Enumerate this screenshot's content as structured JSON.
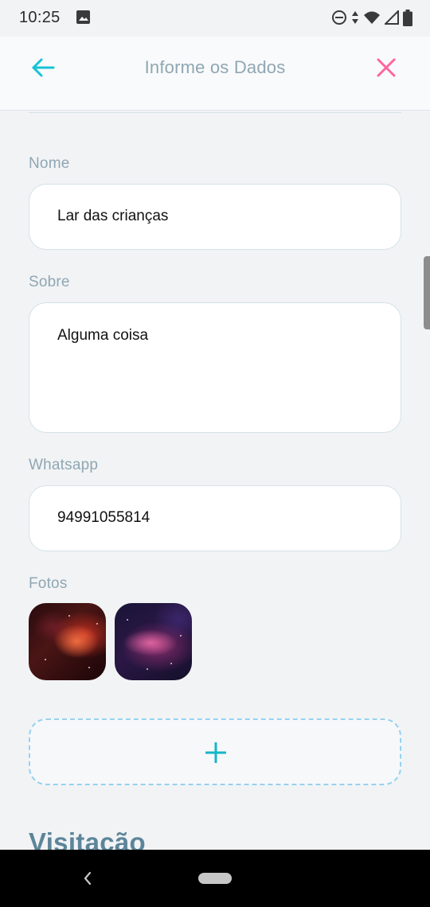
{
  "status_bar": {
    "time": "10:25",
    "icons": [
      "image-icon",
      "do-not-disturb-icon",
      "data-arrows-icon",
      "wifi-icon",
      "signal-icon",
      "battery-icon"
    ]
  },
  "header": {
    "title": "Informe os Dados",
    "back_icon": "arrow-left-icon",
    "close_icon": "close-icon"
  },
  "form": {
    "name_label": "Nome",
    "name_value": "Lar das crianças",
    "about_label": "Sobre",
    "about_value": "Alguma coisa",
    "whatsapp_label": "Whatsapp",
    "whatsapp_value": "94991055814",
    "photos_label": "Fotos",
    "add_photo_icon": "plus-icon"
  },
  "next_section_title": "Visitação",
  "colors": {
    "accent": "#15c3d6",
    "close": "#ff669d",
    "label": "#8fa7b3",
    "input_border": "#d3e2e6",
    "dashed_border": "#96d2f0",
    "section_title": "#5c8599"
  },
  "nav_bar": {
    "back_icon": "nav-back-icon",
    "home_icon": "nav-home-pill"
  }
}
